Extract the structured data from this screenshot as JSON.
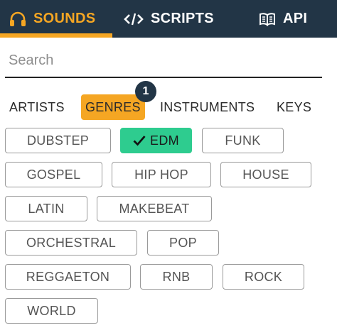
{
  "nav": {
    "tabs": [
      {
        "label": "SOUNDS",
        "icon": "headphones-icon",
        "active": true
      },
      {
        "label": "SCRIPTS",
        "icon": "code-icon"
      },
      {
        "label": "API",
        "icon": "book-icon"
      }
    ]
  },
  "search": {
    "placeholder": "Search",
    "value": ""
  },
  "filters": {
    "tabs": [
      {
        "label": "ARTISTS"
      },
      {
        "label": "GENRES",
        "active": true,
        "badge": "1"
      },
      {
        "label": "INSTRUMENTS"
      },
      {
        "label": "KEYS"
      }
    ]
  },
  "genres": [
    {
      "label": "DUBSTEP"
    },
    {
      "label": "EDM",
      "selected": true
    },
    {
      "label": "FUNK"
    },
    {
      "label": "GOSPEL"
    },
    {
      "label": "HIP HOP"
    },
    {
      "label": "HOUSE"
    },
    {
      "label": "LATIN"
    },
    {
      "label": "MAKEBEAT"
    },
    {
      "label": "ORCHESTRAL"
    },
    {
      "label": "POP"
    },
    {
      "label": "REGGAETON"
    },
    {
      "label": "RNB"
    },
    {
      "label": "ROCK"
    },
    {
      "label": "WORLD"
    }
  ],
  "colors": {
    "nav_bg": "#223546",
    "accent": "#f5a623",
    "selected": "#2ecc8f"
  }
}
